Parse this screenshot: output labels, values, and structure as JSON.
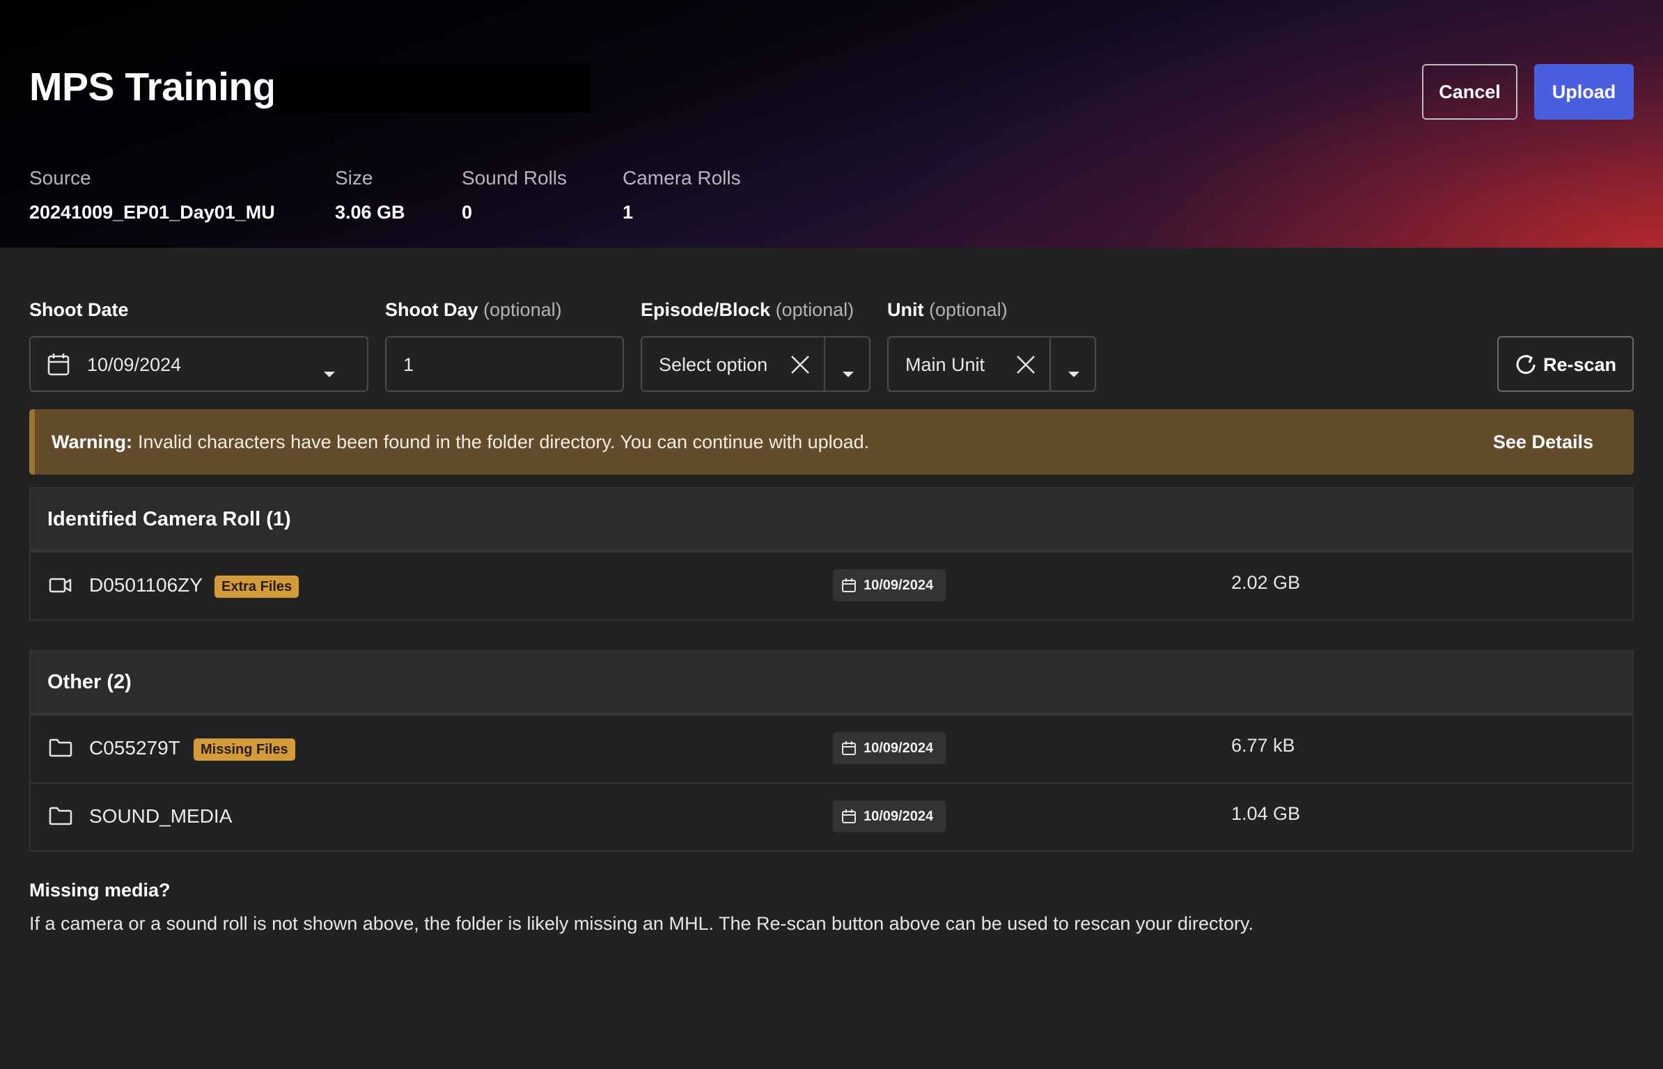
{
  "header": {
    "title": "MPS Training",
    "cancel_label": "Cancel",
    "upload_label": "Upload",
    "meta": [
      {
        "label": "Source",
        "value": "20241009_EP01_Day01_MU"
      },
      {
        "label": "Size",
        "value": "3.06 GB"
      },
      {
        "label": "Sound Rolls",
        "value": "0"
      },
      {
        "label": "Camera Rolls",
        "value": "1"
      }
    ]
  },
  "form": {
    "shoot_date": {
      "label": "Shoot Date",
      "value": "10/09/2024"
    },
    "shoot_day": {
      "label": "Shoot Day",
      "optional": "(optional)",
      "value": "1"
    },
    "episode": {
      "label": "Episode/Block",
      "optional": "(optional)",
      "value": "Select option"
    },
    "unit": {
      "label": "Unit",
      "optional": "(optional)",
      "value": "Main Unit"
    },
    "rescan_label": "Re-scan"
  },
  "warning": {
    "label": "Warning:",
    "text": "Invalid characters have been found in the folder directory. You can continue with upload.",
    "link": "See Details"
  },
  "camera_section": {
    "title": "Identified Camera Roll (1)",
    "rows": [
      {
        "icon": "video-camera-icon",
        "name": "D0501106ZY",
        "badge": "Extra Files",
        "date": "10/09/2024",
        "size": "2.02 GB"
      }
    ]
  },
  "other_section": {
    "title": "Other (2)",
    "rows": [
      {
        "icon": "folder-icon",
        "name": "C055279T",
        "badge": "Missing Files",
        "date": "10/09/2024",
        "size": "6.77 kB"
      },
      {
        "icon": "folder-icon",
        "name": "SOUND_MEDIA",
        "badge": "",
        "date": "10/09/2024",
        "size": "1.04 GB"
      }
    ]
  },
  "footer": {
    "heading": "Missing media?",
    "text": "If a camera or a sound roll is not shown above, the folder is likely missing an MHL. The Re-scan button above can be used to rescan your directory."
  },
  "colors": {
    "accent": "#4a5ee0",
    "badge": "#d49b3a",
    "warning_bg": "#624c2b",
    "background": "#222222"
  }
}
